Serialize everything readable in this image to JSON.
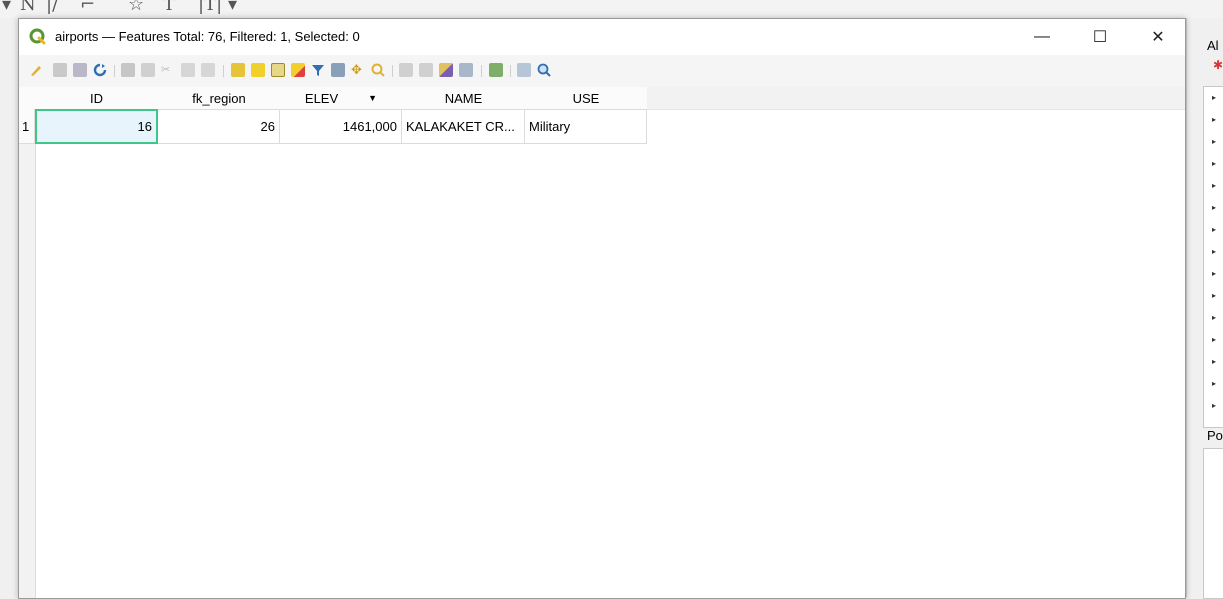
{
  "window": {
    "title": "airports — Features Total: 76, Filtered: 1, Selected: 0",
    "minimize": "—",
    "maximize": "☐",
    "close": "✕"
  },
  "bg": {
    "glyphs": [
      "▾",
      "N",
      "|/",
      "⌐",
      "☆",
      "T",
      "|T|",
      "▾"
    ]
  },
  "right_panel": {
    "title": "Al",
    "bottom_title": "Po",
    "tree_marker": "▸"
  },
  "table": {
    "columns": [
      "ID",
      "fk_region",
      "ELEV",
      "NAME",
      "USE"
    ],
    "sort_indicator": "▼",
    "rows": [
      {
        "row_num": "1",
        "ID": "16",
        "fk_region": "26",
        "ELEV": "1461,000",
        "NAME": "KALAKAKET CR...",
        "USE": "Military"
      }
    ]
  },
  "colors": {
    "accent": "#3dc88a",
    "qgis_green": "#589632",
    "focus_bg": "#e7f4fc"
  }
}
